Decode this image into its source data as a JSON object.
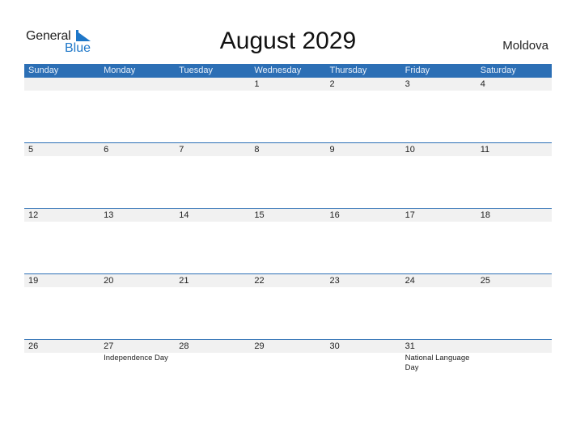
{
  "logo": {
    "word1": "General",
    "word2": "Blue"
  },
  "title": "August 2029",
  "country": "Moldova",
  "weekdays": [
    "Sunday",
    "Monday",
    "Tuesday",
    "Wednesday",
    "Thursday",
    "Friday",
    "Saturday"
  ],
  "weeks": [
    {
      "days": [
        "",
        "",
        "",
        "1",
        "2",
        "3",
        "4"
      ],
      "events": [
        "",
        "",
        "",
        "",
        "",
        "",
        ""
      ]
    },
    {
      "days": [
        "5",
        "6",
        "7",
        "8",
        "9",
        "10",
        "11"
      ],
      "events": [
        "",
        "",
        "",
        "",
        "",
        "",
        ""
      ]
    },
    {
      "days": [
        "12",
        "13",
        "14",
        "15",
        "16",
        "17",
        "18"
      ],
      "events": [
        "",
        "",
        "",
        "",
        "",
        "",
        ""
      ]
    },
    {
      "days": [
        "19",
        "20",
        "21",
        "22",
        "23",
        "24",
        "25"
      ],
      "events": [
        "",
        "",
        "",
        "",
        "",
        "",
        ""
      ]
    },
    {
      "days": [
        "26",
        "27",
        "28",
        "29",
        "30",
        "31",
        ""
      ],
      "events": [
        "",
        "Independence Day",
        "",
        "",
        "",
        "National Language Day",
        ""
      ]
    }
  ],
  "colors": {
    "header": "#2c6fb5",
    "brand_blue": "#1e77c8",
    "day_bar": "#f1f1f1"
  }
}
